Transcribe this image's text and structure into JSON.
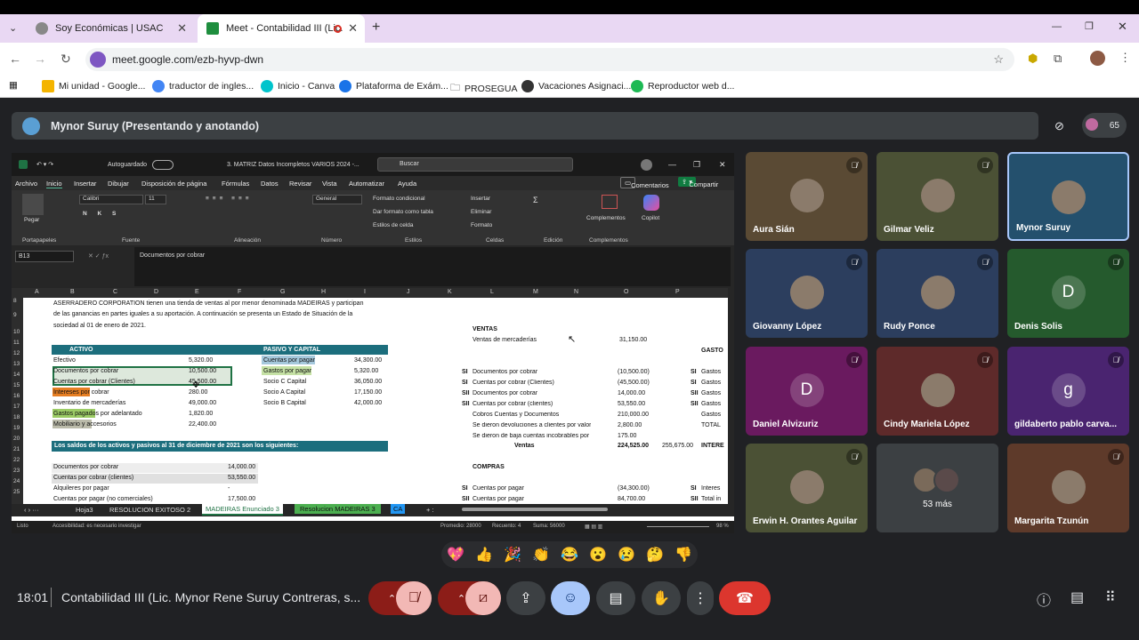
{
  "browser": {
    "tabs": [
      {
        "title": "Soy Económicas | USAC"
      },
      {
        "title": "Meet - Contabilidad III (Lic."
      }
    ],
    "url": "meet.google.com/ezb-hyvp-dwn",
    "bookmarks": [
      "Mi unidad - Google...",
      "traductor de ingles...",
      "Inicio - Canva",
      "Plataforma de Exám...",
      "PROSEGUA",
      "Vacaciones Asignaci...",
      "Reproductor web d..."
    ]
  },
  "meet": {
    "presenter": "Mynor Suruy (Presentando y anotando)",
    "participant_count": "65",
    "time": "18:01",
    "meeting_title": "Contabilidad III (Lic. Mynor Rene Suruy Contreras, s...",
    "reactions": [
      "💖",
      "👍",
      "🎉",
      "👏",
      "😂",
      "😮",
      "😢",
      "🤔",
      "👎"
    ],
    "more_label": "53 más",
    "participants": [
      {
        "name": "Aura Sián",
        "muted": true,
        "bg": "#5a4a34"
      },
      {
        "name": "Gilmar Veliz",
        "muted": true,
        "bg": "#4b5135"
      },
      {
        "name": "Mynor Suruy",
        "muted": false,
        "bg": "#24506d"
      },
      {
        "name": "Giovanny López",
        "muted": true,
        "bg": "#2c3e5e"
      },
      {
        "name": "Rudy Ponce",
        "muted": true,
        "bg": "#2c3e5e"
      },
      {
        "name": "Denis Solis",
        "letter": "D",
        "muted": true,
        "bg": "#255a2d"
      },
      {
        "name": "Daniel Alvizuriz",
        "letter": "D",
        "muted": true,
        "bg": "#6a1a5f"
      },
      {
        "name": "Cindy Mariela López",
        "muted": true,
        "bg": "#5e2a2a"
      },
      {
        "name": "gildaberto pablo carva...",
        "letter": "g",
        "muted": true,
        "bg": "#4a2470"
      },
      {
        "name": "Erwin H. Orantes Aguilar",
        "muted": true,
        "bg": "#4b5135"
      },
      {
        "name": "Margarita Tzunún",
        "muted": true,
        "bg": "#5e3a2a"
      }
    ]
  },
  "excel": {
    "autosave": "Autoguardado",
    "filename": "3. MATRIZ  Datos Incompletos VARIOS 2024  -...",
    "search": "Buscar",
    "menu": [
      "Archivo",
      "Inicio",
      "Insertar",
      "Dibujar",
      "Disposición de página",
      "Fórmulas",
      "Datos",
      "Revisar",
      "Vista",
      "Automatizar",
      "Ayuda"
    ],
    "comments": "Comentarios",
    "share": "Compartir",
    "ribbon": {
      "font": "Calibri",
      "size": "11",
      "number_format": "General",
      "groups": [
        "Portapapeles",
        "Fuente",
        "Alineación",
        "Número",
        "Estilos",
        "Celdas",
        "Edición",
        "Complementos"
      ],
      "styles": [
        "Formato condicional",
        "Dar formato como tabla",
        "Estilos de celda"
      ],
      "cells": [
        "Insertar",
        "Eliminar",
        "Formato"
      ],
      "complementos": "Complementos",
      "copilot": "Copilot",
      "pegar": "Pegar"
    },
    "namebox": "B13",
    "formula": "Documentos por cobrar",
    "columns": [
      "A",
      "B",
      "C",
      "D",
      "E",
      "F",
      "G",
      "H",
      "I",
      "J",
      "K",
      "L",
      "M",
      "N",
      "O",
      "P"
    ],
    "rows": [
      "8",
      "9",
      "10",
      "11",
      "12",
      "13",
      "14",
      "15",
      "16",
      "17",
      "18",
      "19",
      "20",
      "21",
      "22",
      "23",
      "24",
      "25"
    ],
    "intro": [
      "ASERRADERO CORPORATION tienen una tienda de ventas al por menor denominada MADEIRAS y participan",
      "de las ganancias en partes iguales a su aportación.  A continuación se presenta un Estado de Situación de la",
      "sociedad al 01 de enero de 2021."
    ],
    "activo_header": "ACTIVO",
    "pasivo_header": "PASIVO Y CAPITAL",
    "activo": [
      [
        "Efectivo",
        "5,320.00"
      ],
      [
        "Documentos por cobrar",
        "10,500.00"
      ],
      [
        "Cuentas por cobrar (Clientes)",
        "45,500.00"
      ],
      [
        "Intereses por cobrar",
        "280.00"
      ],
      [
        "Inventario de mercaderías",
        "49,000.00"
      ],
      [
        "Gastos pagados por adelantado",
        "1,820.00"
      ],
      [
        "Mobiliario y accesorios",
        "22,400.00"
      ]
    ],
    "pasivo": [
      [
        "Cuentas por pagar",
        "34,300.00"
      ],
      [
        "Gastos por pagar",
        "5,320.00"
      ],
      [
        "Socio C Capital",
        "36,050.00"
      ],
      [
        "Socio A Capital",
        "17,150.00"
      ],
      [
        "Socio B Capital",
        "42,000.00"
      ]
    ],
    "saldos_header": "Los saldos de los activos y pasivos al 31 de diciembre de 2021 son los siguientes:",
    "saldos": [
      [
        "Documentos por cobrar",
        "14,000.00"
      ],
      [
        "Cuentas por cobrar (clientes)",
        "53,550.00"
      ],
      [
        "Alquileres por pagar",
        "-"
      ],
      [
        "Cuentas por pagar (no comerciales)",
        "17,500.00"
      ]
    ],
    "ventas_title": "VENTAS",
    "ventas_merc": [
      "Ventas de mercaderías",
      "31,150.00"
    ],
    "gastos_label": "GASTO",
    "ventas": [
      [
        "SI",
        "Documentos por cobrar",
        "(10,500.00)",
        "SI",
        "Gastos"
      ],
      [
        "SI",
        "Cuentas por cobrar (Clientes)",
        "(45,500.00)",
        "SI",
        "Gastos"
      ],
      [
        "SII",
        "Documentos por cobrar",
        "14,000.00",
        "SII",
        "Gastos"
      ],
      [
        "SII",
        "Cuentas por cobrar (clientes)",
        "53,550.00",
        "SII",
        "Gastos"
      ],
      [
        "",
        "Cobros Cuentas y Documentos",
        "210,000.00",
        "",
        "Gastos"
      ],
      [
        "",
        "Se dieron devoluciones a clientes por valor",
        "2,800.00",
        "",
        "TOTAL"
      ],
      [
        "",
        "Se dieron de baja cuentas incobrables por",
        "175.00",
        "",
        ""
      ]
    ],
    "ventas_total": [
      "Ventas",
      "224,525.00",
      "255,675.00",
      "INTERE"
    ],
    "compras_title": "COMPRAS",
    "compras": [
      [
        "SI",
        "Cuentas por pagar",
        "(34,300.00)",
        "SI",
        "Interes"
      ],
      [
        "SII",
        "Cuentas por pagar",
        "84,700.00",
        "SII",
        "Total in"
      ]
    ],
    "sheets": [
      "Hoja3",
      "RESOLUCION EXITOSO 2",
      "MADEIRAS Enunciado 3",
      "Resolucion MADEIRAS 3",
      "CA"
    ],
    "status": {
      "ready": "Listo",
      "accessibility": "Accesibilidad: es necesario investigar",
      "promedio": "Promedio: 28000",
      "recuento": "Recuento: 4",
      "suma": "Suma: 56000",
      "zoom": "98 %"
    }
  }
}
